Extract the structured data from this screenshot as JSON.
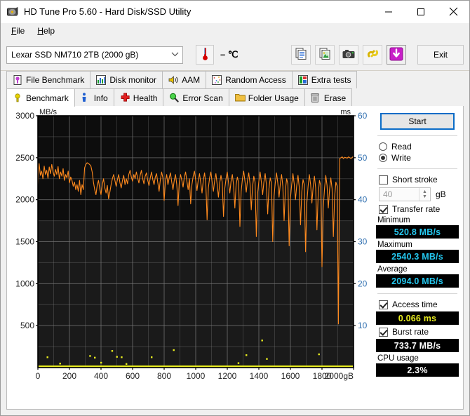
{
  "window": {
    "title": "HD Tune Pro 5.60 - Hard Disk/SSD Utility",
    "icon": "hard-disk-icon",
    "minimize": "–",
    "maximize": "☐",
    "close": "✕"
  },
  "menu": {
    "items": [
      {
        "label": "File",
        "mnemonic": "F"
      },
      {
        "label": "Help",
        "mnemonic": "H"
      }
    ]
  },
  "toolbar": {
    "drive": "Lexar SSD NM710 2TB (2000 gB)",
    "drive_chevron": "chevron-down-icon",
    "temperature": "– ℃",
    "thermometer_icon": "thermometer-icon",
    "buttons": [
      {
        "name": "copy-icon",
        "label": ""
      },
      {
        "name": "copy-image-icon",
        "label": ""
      },
      {
        "name": "camera-icon",
        "label": ""
      },
      {
        "name": "link-icon",
        "label": ""
      },
      {
        "name": "download-icon",
        "label": ""
      }
    ],
    "exit_label": "Exit"
  },
  "tabs": {
    "row1": [
      {
        "label": "File Benchmark",
        "icon": "file-benchmark-icon",
        "active": false
      },
      {
        "label": "Disk monitor",
        "icon": "disk-monitor-icon",
        "active": false
      },
      {
        "label": "AAM",
        "icon": "speaker-icon",
        "active": false
      },
      {
        "label": "Random Access",
        "icon": "random-access-icon",
        "active": false
      },
      {
        "label": "Extra tests",
        "icon": "extra-tests-icon",
        "active": false
      }
    ],
    "row2": [
      {
        "label": "Benchmark",
        "icon": "benchmark-icon",
        "active": true
      },
      {
        "label": "Info",
        "icon": "info-icon",
        "active": false
      },
      {
        "label": "Health",
        "icon": "health-icon",
        "active": false
      },
      {
        "label": "Error Scan",
        "icon": "magnifier-icon",
        "active": false
      },
      {
        "label": "Folder Usage",
        "icon": "folder-icon",
        "active": false
      },
      {
        "label": "Erase",
        "icon": "trash-icon",
        "active": false
      }
    ]
  },
  "panel": {
    "start_label": "Start",
    "mode": {
      "read_label": "Read",
      "write_label": "Write",
      "selected": "Write"
    },
    "short_stroke": {
      "label": "Short stroke",
      "checked": false,
      "value": "40",
      "unit": "gB"
    },
    "transfer_rate": {
      "label": "Transfer rate",
      "checked": true
    },
    "minimum": {
      "label": "Minimum",
      "value": "520.8 MB/s",
      "color": "#24c8f0"
    },
    "maximum": {
      "label": "Maximum",
      "value": "2540.3 MB/s",
      "color": "#24c8f0"
    },
    "average": {
      "label": "Average",
      "value": "2094.0 MB/s",
      "color": "#24c8f0"
    },
    "access_time": {
      "label": "Access time",
      "checked": true,
      "value": "0.066 ms",
      "color": "#e8ec1f"
    },
    "burst_rate": {
      "label": "Burst rate",
      "checked": true,
      "value": "733.7 MB/s",
      "color": "#ffffff"
    },
    "cpu_usage": {
      "label": "CPU usage",
      "value": "2.3%",
      "color": "#ffffff"
    }
  },
  "chart_data": {
    "type": "line",
    "title": "",
    "xlabel": "gB",
    "ylabel": "MB/s",
    "y2label": "ms",
    "xlim": [
      0,
      2000
    ],
    "ylim": [
      0,
      3000
    ],
    "y2lim": [
      0,
      60
    ],
    "grid": true,
    "plot_bg": "#0d0d0d",
    "grid_color": "#6f6f6f",
    "xticks": [
      0,
      200,
      400,
      600,
      800,
      1000,
      1200,
      1400,
      1600,
      1800,
      2000
    ],
    "yticks": [
      0,
      500,
      1000,
      1500,
      2000,
      2500,
      3000
    ],
    "y2ticks": [
      0,
      10,
      20,
      30,
      40,
      50,
      60
    ],
    "xtick_color": "#222222",
    "ytick_color": "#222222",
    "y2tick_color": "#2f6fb0",
    "series": [
      {
        "name": "Transfer rate",
        "color": "#ff8a1e",
        "axis": "left",
        "units": "MB/s",
        "x": [
          0,
          8,
          16,
          24,
          32,
          40,
          48,
          56,
          64,
          72,
          80,
          88,
          96,
          104,
          112,
          120,
          128,
          136,
          144,
          152,
          160,
          168,
          176,
          184,
          192,
          200,
          208,
          216,
          224,
          232,
          240,
          248,
          256,
          264,
          272,
          280,
          288,
          296,
          304,
          312,
          320,
          328,
          336,
          344,
          352,
          360,
          368,
          376,
          384,
          392,
          400,
          408,
          416,
          424,
          432,
          440,
          448,
          456,
          464,
          472,
          480,
          488,
          496,
          504,
          512,
          520,
          528,
          536,
          544,
          552,
          560,
          568,
          576,
          584,
          592,
          600,
          608,
          616,
          624,
          632,
          640,
          648,
          656,
          664,
          672,
          680,
          688,
          696,
          704,
          712,
          720,
          728,
          736,
          744,
          752,
          760,
          768,
          776,
          784,
          792,
          800,
          808,
          816,
          824,
          832,
          840,
          848,
          856,
          864,
          872,
          880,
          888,
          896,
          904,
          912,
          920,
          928,
          936,
          944,
          952,
          960,
          968,
          976,
          984,
          992,
          1000,
          1008,
          1016,
          1024,
          1032,
          1040,
          1048,
          1056,
          1064,
          1072,
          1080,
          1088,
          1096,
          1104,
          1112,
          1120,
          1128,
          1136,
          1144,
          1152,
          1160,
          1168,
          1176,
          1184,
          1192,
          1200,
          1208,
          1216,
          1224,
          1232,
          1240,
          1248,
          1256,
          1264,
          1272,
          1280,
          1288,
          1296,
          1304,
          1312,
          1320,
          1328,
          1336,
          1344,
          1352,
          1360,
          1368,
          1376,
          1384,
          1392,
          1400,
          1408,
          1416,
          1424,
          1432,
          1440,
          1448,
          1456,
          1464,
          1472,
          1480,
          1488,
          1496,
          1504,
          1512,
          1520,
          1528,
          1536,
          1544,
          1552,
          1560,
          1568,
          1576,
          1584,
          1592,
          1600,
          1608,
          1616,
          1624,
          1632,
          1640,
          1648,
          1656,
          1664,
          1672,
          1680,
          1688,
          1696,
          1704,
          1712,
          1720,
          1728,
          1736,
          1744,
          1752,
          1760,
          1768,
          1776,
          1784,
          1792,
          1800,
          1808,
          1816,
          1824,
          1832,
          1840,
          1848,
          1856,
          1864,
          1872,
          1880,
          1888,
          1896,
          1904,
          1912,
          1920,
          1928,
          1936,
          1944,
          1952,
          1960,
          1968,
          1976,
          1984,
          1992,
          2000
        ],
        "y": [
          2180,
          2430,
          2290,
          2340,
          2250,
          2400,
          2300,
          2350,
          2255,
          2390,
          2310,
          2420,
          2330,
          2280,
          2360,
          2300,
          2395,
          2250,
          2330,
          2280,
          2370,
          2230,
          2300,
          2260,
          2340,
          2200,
          2270,
          2230,
          2160,
          2210,
          2120,
          2180,
          2100,
          2230,
          2060,
          2180,
          2120,
          2380,
          2420,
          2440,
          2430,
          2420,
          2400,
          2330,
          2210,
          2120,
          2060,
          2170,
          2230,
          2130,
          2060,
          2180,
          2250,
          2140,
          2080,
          2170,
          2010,
          2090,
          2180,
          2250,
          2300,
          2230,
          2160,
          2240,
          2300,
          2200,
          2140,
          2230,
          2290,
          2180,
          2250,
          2190,
          2300,
          2350,
          2270,
          2220,
          2300,
          2250,
          2330,
          2260,
          2200,
          2290,
          2350,
          2250,
          2190,
          2280,
          2320,
          2230,
          2170,
          2260,
          2330,
          2240,
          2180,
          2270,
          2310,
          2200,
          2100,
          2240,
          2330,
          2260,
          1990,
          2220,
          2300,
          2180,
          2260,
          2320,
          2210,
          2120,
          2230,
          2300,
          2180,
          1930,
          2210,
          2300,
          2230,
          2150,
          2270,
          2330,
          2220,
          2120,
          2250,
          1950,
          2180,
          2280,
          2340,
          2230,
          2110,
          2230,
          2310,
          2200,
          2080,
          2230,
          2320,
          2190,
          1760,
          2140,
          2260,
          2330,
          2210,
          2100,
          2230,
          2310,
          2180,
          2030,
          2200,
          2290,
          2210,
          1800,
          2130,
          2250,
          2330,
          2200,
          2080,
          2220,
          2300,
          2170,
          1900,
          2180,
          2270,
          2200,
          1680,
          2100,
          2250,
          2340,
          2220,
          2090,
          2230,
          2320,
          2190,
          1880,
          2150,
          2280,
          2210,
          1560,
          2070,
          2220,
          2330,
          2210,
          2060,
          2210,
          2310,
          2180,
          1830,
          2130,
          2260,
          2200,
          1500,
          2040,
          2200,
          2320,
          2200,
          2030,
          2190,
          2300,
          2160,
          1750,
          2110,
          2250,
          2190,
          1450,
          2010,
          2180,
          2310,
          2190,
          2000,
          2170,
          2290,
          2150,
          1700,
          2090,
          2240,
          2180,
          1380,
          1960,
          2160,
          2300,
          2180,
          1960,
          2150,
          2280,
          2140,
          1640,
          2060,
          2230,
          2170,
          1200,
          1900,
          2130,
          2290,
          2170,
          1900,
          2120,
          2260,
          2130,
          1560,
          2030,
          2210,
          2160,
          520,
          2490,
          2500,
          2510,
          2490,
          2505,
          2500,
          2495,
          2510,
          2500,
          2490,
          2505,
          2515,
          2495,
          2500,
          2510,
          2490,
          2500,
          2505,
          2495,
          2510,
          2500,
          2495,
          2505,
          2510,
          2490,
          2500,
          2505,
          2495,
          2510,
          2500,
          2505,
          2495
        ]
      },
      {
        "name": "Access time",
        "color": "#e8ec1f",
        "axis": "right",
        "units": "ms",
        "baseline": 0.3,
        "spikes_ms": [
          {
            "x": 60,
            "y": 2.5
          },
          {
            "x": 140,
            "y": 1.0
          },
          {
            "x": 330,
            "y": 2.8
          },
          {
            "x": 360,
            "y": 2.4
          },
          {
            "x": 400,
            "y": 1.2
          },
          {
            "x": 470,
            "y": 4.0
          },
          {
            "x": 500,
            "y": 2.6
          },
          {
            "x": 530,
            "y": 2.5
          },
          {
            "x": 560,
            "y": 0.9
          },
          {
            "x": 720,
            "y": 2.5
          },
          {
            "x": 860,
            "y": 4.2
          },
          {
            "x": 1270,
            "y": 1.1
          },
          {
            "x": 1320,
            "y": 3.0
          },
          {
            "x": 1420,
            "y": 6.5
          },
          {
            "x": 1450,
            "y": 2.1
          },
          {
            "x": 1780,
            "y": 3.2
          }
        ]
      }
    ]
  }
}
